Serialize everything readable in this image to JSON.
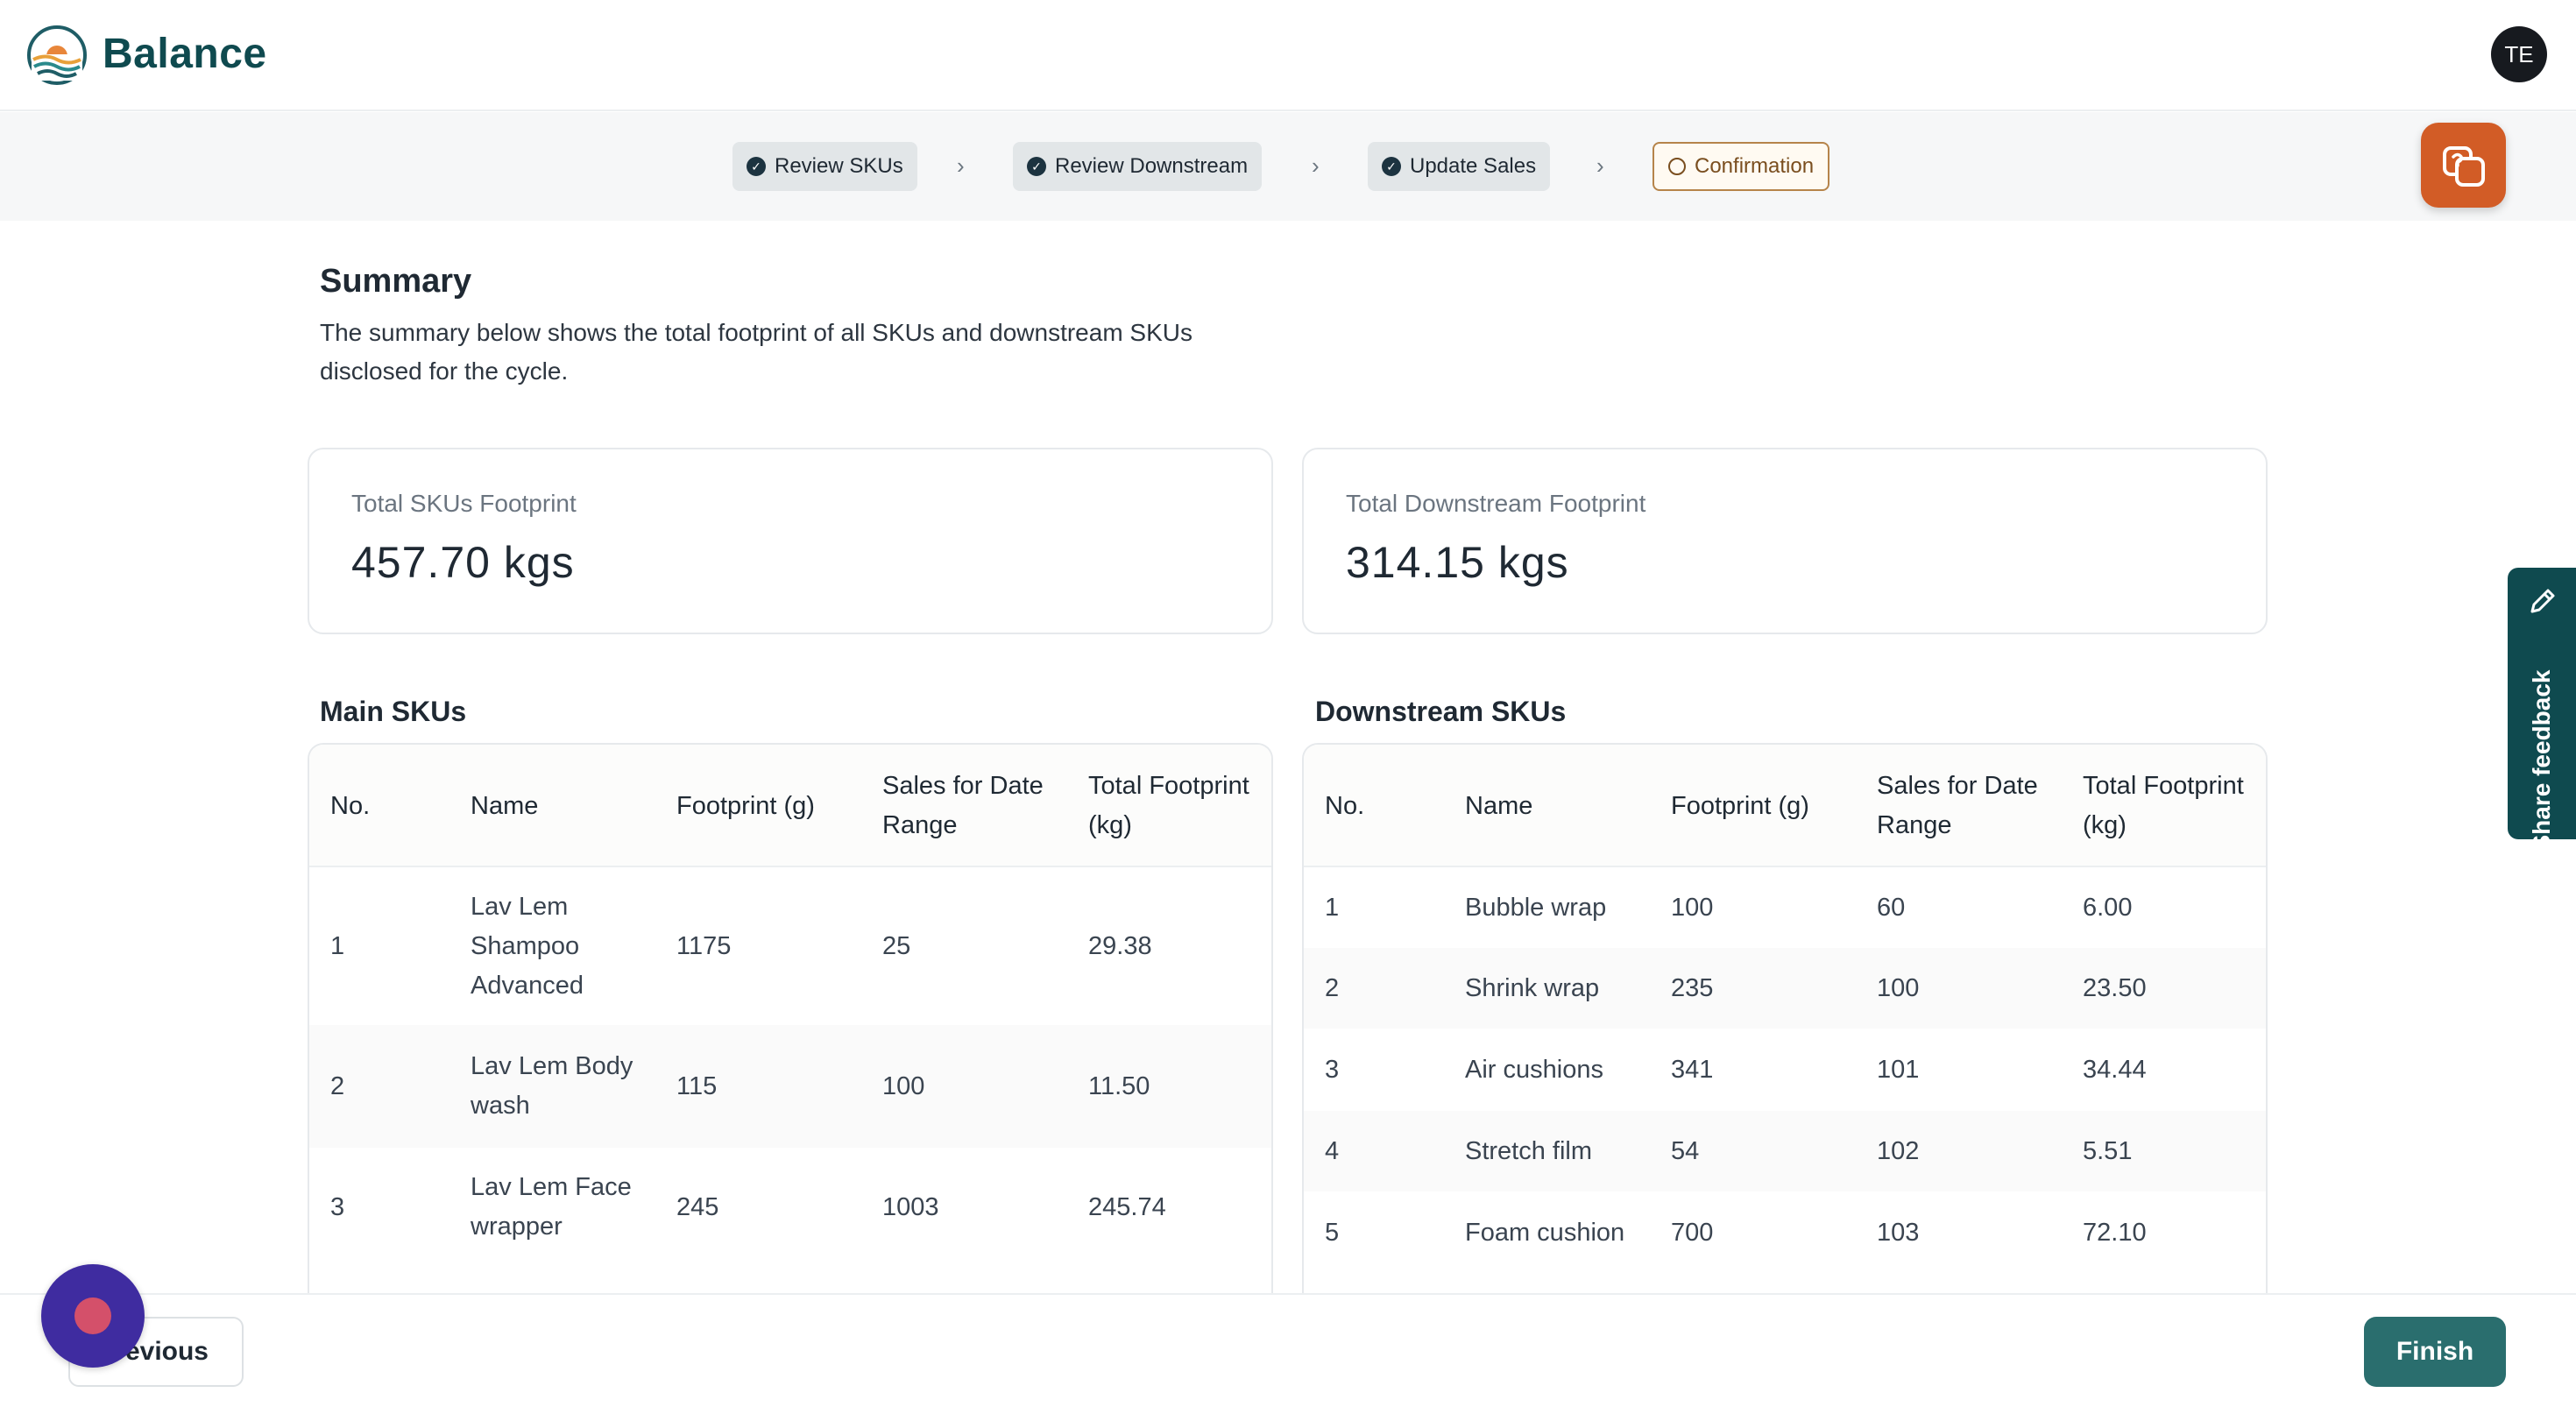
{
  "app": {
    "brand": "Balance",
    "user_initials": "TE"
  },
  "stepper": {
    "steps": [
      {
        "label": "Review SKUs",
        "status": "complete"
      },
      {
        "label": "Review Downstream",
        "status": "complete"
      },
      {
        "label": "Update Sales",
        "status": "complete"
      },
      {
        "label": "Confirmation",
        "status": "current"
      }
    ]
  },
  "summary": {
    "title": "Summary",
    "description": "The summary below shows the total footprint of all SKUs and downstream SKUs disclosed for the cycle."
  },
  "cards": {
    "skus": {
      "label": "Total SKUs Footprint",
      "value": "457.70 kgs"
    },
    "downstream": {
      "label": "Total Downstream Footprint",
      "value": "314.15 kgs"
    }
  },
  "main_skus": {
    "title": "Main SKUs",
    "columns": [
      "No.",
      "Name",
      "Footprint (g)",
      "Sales for Date Range",
      "Total Footprint (kg)"
    ],
    "rows": [
      [
        "1",
        "Lav Lem Shampoo Advanced",
        "1175",
        "25",
        "29.38"
      ],
      [
        "2",
        "Lav Lem Body wash",
        "115",
        "100",
        "11.50"
      ],
      [
        "3",
        "Lav Lem Face wrapper",
        "245",
        "1003",
        "245.74"
      ]
    ]
  },
  "downstream_skus": {
    "title": "Downstream SKUs",
    "columns": [
      "No.",
      "Name",
      "Footprint (g)",
      "Sales for Date Range",
      "Total Footprint (kg)"
    ],
    "rows": [
      [
        "1",
        "Bubble wrap",
        "100",
        "60",
        "6.00"
      ],
      [
        "2",
        "Shrink wrap",
        "235",
        "100",
        "23.50"
      ],
      [
        "3",
        "Air cushions",
        "341",
        "101",
        "34.44"
      ],
      [
        "4",
        "Stretch film",
        "54",
        "102",
        "5.51"
      ],
      [
        "5",
        "Foam cushion",
        "700",
        "103",
        "72.10"
      ]
    ]
  },
  "footer": {
    "previous_label": "revious",
    "finish_label": "Finish"
  },
  "feedback": {
    "label": "Share feedback"
  },
  "colors": {
    "brand": "#0f4a4f",
    "accent": "#d25c26",
    "finish": "#2a6e6e",
    "record": "#3f2ca0"
  },
  "icons": [
    "logo-icon",
    "check-circle-icon",
    "chevron-right-icon",
    "circle-outline-icon",
    "help-chat-icon",
    "pencil-icon",
    "record-icon"
  ]
}
